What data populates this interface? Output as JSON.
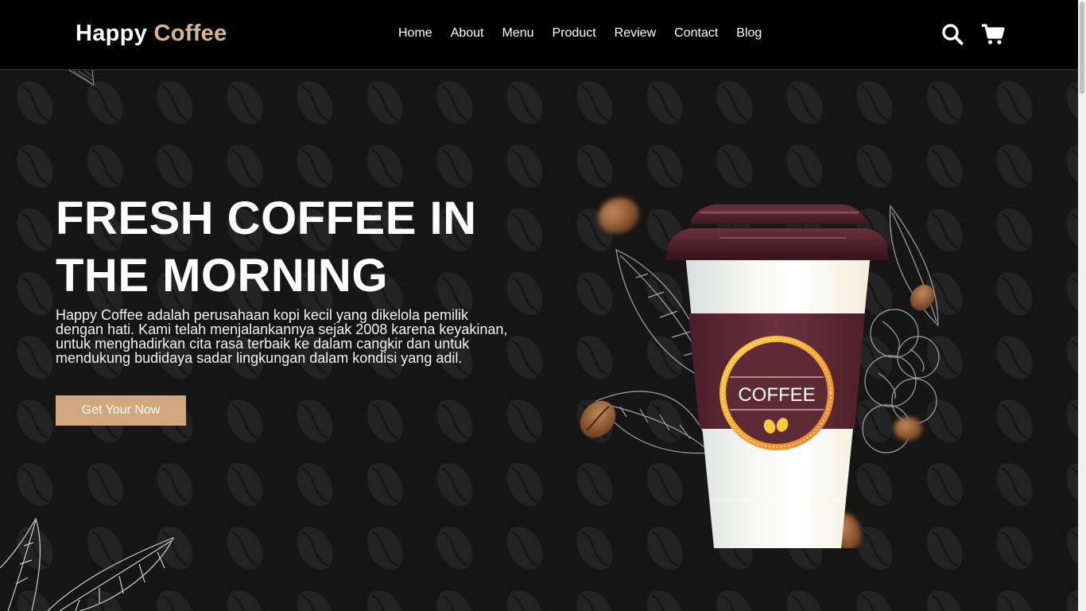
{
  "brand": {
    "first": "Happy",
    "second": "Coffee"
  },
  "nav": {
    "links": [
      "Home",
      "About",
      "Menu",
      "Product",
      "Review",
      "Contact",
      "Blog"
    ],
    "icons": [
      "search-icon",
      "cart-icon"
    ]
  },
  "hero": {
    "title_line1": "FRESH COFFEE IN",
    "title_line2": "THE MORNING",
    "description": "Happy Coffee adalah perusahaan kopi kecil yang dikelola pemilik dengan hati. Kami telah menjalankannya sejak 2008 karena keyakinan, untuk menghadirkan cita rasa terbaik ke dalam cangkir dan untuk mendukung budidaya sadar lingkungan dalam kondisi yang adil.",
    "button_label": "Get Your Now"
  },
  "cup": {
    "label": "COFFEE"
  },
  "colors": {
    "accent": "#d9b68c",
    "button": "#d1a77d",
    "background": "#161616",
    "navbar": "#000000",
    "cup_sleeve": "#5a2632"
  }
}
